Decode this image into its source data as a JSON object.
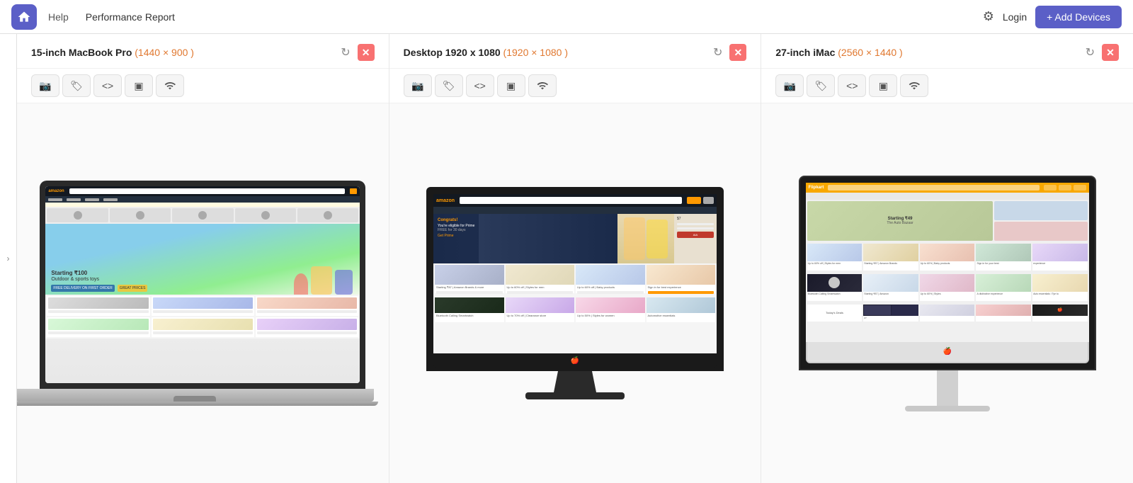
{
  "header": {
    "logo_label": "Home",
    "nav_help": "Help",
    "nav_report": "Performance Report",
    "login_label": "Login",
    "add_devices_label": "+ Add Devices",
    "settings_label": "Settings"
  },
  "sidebar": {
    "arrow_label": "›"
  },
  "devices": [
    {
      "id": "macbook",
      "title": "15-inch MacBook Pro",
      "resolution_display": "(1440 × 900 )",
      "resolution": "1440 × 900",
      "type": "laptop",
      "toolbar": {
        "screenshot": "📷",
        "tag": "🏷",
        "code": "<>",
        "record": "🎥",
        "wifi": "📶"
      }
    },
    {
      "id": "desktop",
      "title": "Desktop 1920 x 1080",
      "resolution_display": "(1920 × 1080 )",
      "resolution": "1920 × 1080",
      "type": "monitor",
      "toolbar": {
        "screenshot": "📷",
        "tag": "🏷",
        "code": "<>",
        "record": "🎥",
        "wifi": "📶"
      }
    },
    {
      "id": "imac",
      "title": "27-inch iMac",
      "resolution_display": "(2560 × 1440 )",
      "resolution": "2560 × 1440",
      "type": "imac",
      "toolbar": {
        "screenshot": "📷",
        "tag": "🏷",
        "code": "<>",
        "record": "🎥",
        "wifi": "📶"
      }
    }
  ]
}
